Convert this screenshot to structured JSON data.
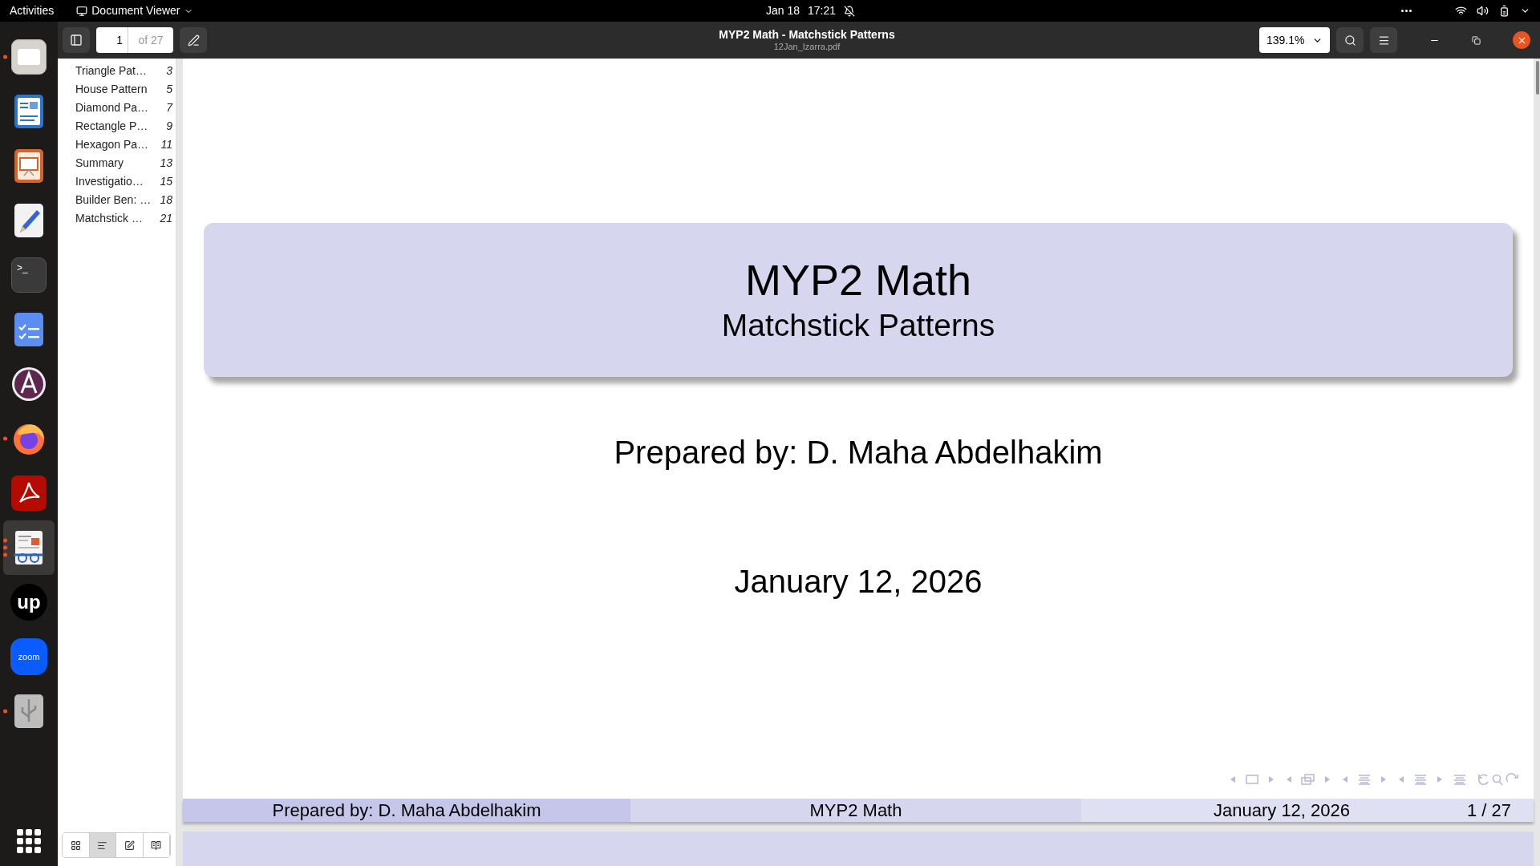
{
  "top_bar": {
    "activities": "Activities",
    "app_menu": "Document Viewer",
    "date": "Jan 18",
    "time": "17:21"
  },
  "dock": [
    {
      "kind": "files",
      "running": true,
      "selected": false
    },
    {
      "kind": "writer",
      "running": false,
      "selected": false
    },
    {
      "kind": "impress",
      "running": false,
      "selected": false
    },
    {
      "kind": "editor",
      "running": false,
      "selected": false
    },
    {
      "kind": "terminal",
      "label": ">_",
      "running": false,
      "selected": false
    },
    {
      "kind": "tasks",
      "running": false,
      "selected": false
    },
    {
      "kind": "store",
      "running": false,
      "selected": false
    },
    {
      "kind": "firefox",
      "running": true,
      "selected": false
    },
    {
      "kind": "acrobat",
      "running": false,
      "selected": false
    },
    {
      "kind": "viewer",
      "running": true,
      "selected": true
    },
    {
      "kind": "upwork",
      "label": "up",
      "running": false,
      "selected": false
    },
    {
      "kind": "zoom",
      "label": "zoom",
      "running": false,
      "selected": false
    },
    {
      "kind": "usb",
      "running": true,
      "selected": false
    }
  ],
  "header": {
    "page_number": "1",
    "page_count": "of 27",
    "title": "MYP2 Math - Matchstick Patterns",
    "subtitle": "12Jan_Izarra.pdf",
    "zoom": "139.1%"
  },
  "outline": [
    {
      "title": "Triangle Pat…",
      "page": "3"
    },
    {
      "title": "House Pattern",
      "page": "5"
    },
    {
      "title": "Diamond Pa…",
      "page": "7"
    },
    {
      "title": "Rectangle P…",
      "page": "9"
    },
    {
      "title": "Hexagon Pa…",
      "page": "11"
    },
    {
      "title": "Summary",
      "page": "13"
    },
    {
      "title": "Investigatio…",
      "page": "15"
    },
    {
      "title": "Builder Ben: …",
      "page": "18"
    },
    {
      "title": "Matchstick …",
      "page": "21"
    }
  ],
  "sidebar_modes": [
    {
      "kind": "thumbnails",
      "selected": false
    },
    {
      "kind": "outline",
      "selected": true
    },
    {
      "kind": "annotations",
      "selected": false
    },
    {
      "kind": "attachments",
      "selected": false
    }
  ],
  "slide": {
    "title": "MYP2 Math",
    "subtitle": "Matchstick Patterns",
    "author": "Prepared by: D. Maha Abdelhakim",
    "date": "January 12, 2026",
    "footer": {
      "author": "Prepared by: D. Maha Abdelhakim",
      "title": "MYP2 Math",
      "date": "January 12, 2026",
      "page": "1 / 27"
    }
  }
}
